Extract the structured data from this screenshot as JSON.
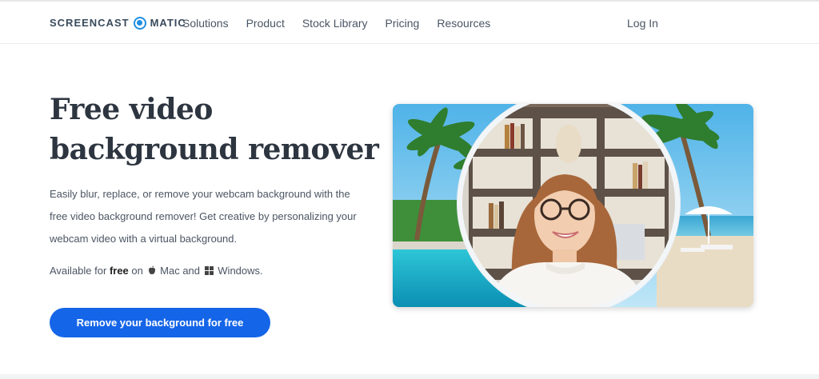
{
  "nav": {
    "logo_left": "SCREENCAST",
    "logo_right": "MATIC",
    "links": [
      "Solutions",
      "Product",
      "Stock Library",
      "Pricing",
      "Resources"
    ],
    "login": "Log In"
  },
  "hero": {
    "headline": "Free video background remover",
    "description": "Easily blur, replace, or remove your webcam background with the free video background remover! Get creative by personalizing your webcam video with a virtual background.",
    "availability": {
      "prefix": "Available for",
      "free": "free",
      "on": "on",
      "mac": "Mac",
      "and": "and",
      "windows": "Windows."
    },
    "cta_label": "Remove your background for free",
    "image_icon": "webcam-background-removal-illustration"
  },
  "colors": {
    "brand": "#1e8fe1",
    "cta": "#1565e8",
    "heading": "#2d3540"
  }
}
